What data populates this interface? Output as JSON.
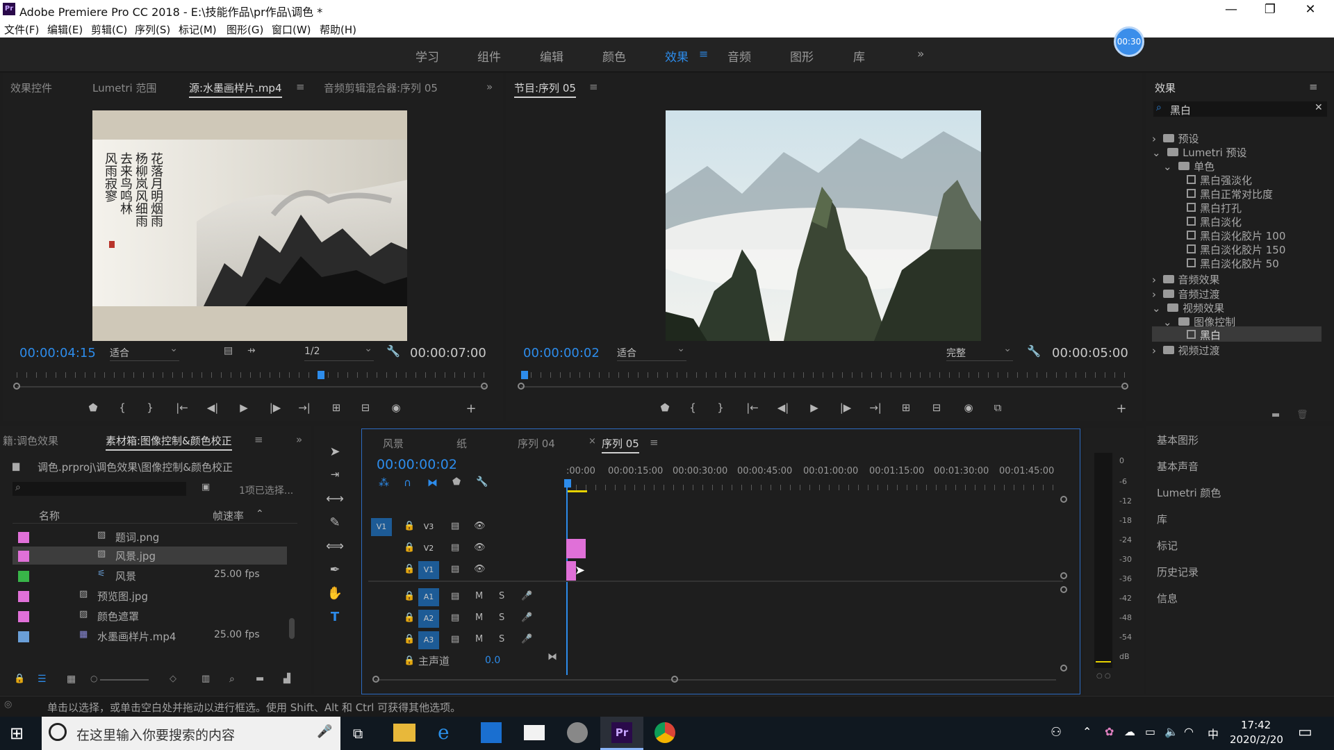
{
  "app": {
    "title": "Adobe Premiere Pro CC 2018 - E:\\技能作品\\pr作品\\调色 *",
    "logo": "Pr"
  },
  "menu": [
    "文件(F)",
    "编辑(E)",
    "剪辑(C)",
    "序列(S)",
    "标记(M)",
    "图形(G)",
    "窗口(W)",
    "帮助(H)"
  ],
  "workspaces": {
    "tabs": [
      "学习",
      "组件",
      "编辑",
      "颜色",
      "效果",
      "音频",
      "图形",
      "库"
    ],
    "active": "效果",
    "more": "»"
  },
  "timer_badge": "00:30",
  "source_panel": {
    "tabs": [
      "效果控件",
      "Lumetri 范围",
      "源:水墨画样片.mp4",
      "音频剪辑混合器:序列 05"
    ],
    "active_tab": "源:水墨画样片.mp4",
    "timecode_in": "00:00:04:15",
    "fit": "适合",
    "resolution": "1/2",
    "duration": "00:00:07:00",
    "calligraphy": "花落月明烟雨\n杨柳岚风细雨\n去来鸟鸣林\n风雨寂寥"
  },
  "program_panel": {
    "title": "节目:序列 05",
    "timecode": "00:00:00:02",
    "fit": "适合",
    "quality": "完整",
    "duration": "00:00:05:00"
  },
  "effects_panel": {
    "title": "效果",
    "search_value": "黑白",
    "tree": [
      {
        "label": "预设",
        "kind": "folder",
        "level": 0,
        "open": false
      },
      {
        "label": "Lumetri 预设",
        "kind": "folder",
        "level": 0,
        "open": true
      },
      {
        "label": "单色",
        "kind": "folder",
        "level": 1,
        "open": true
      },
      {
        "label": "黑白强淡化",
        "kind": "fx",
        "level": 2
      },
      {
        "label": "黑白正常对比度",
        "kind": "fx",
        "level": 2
      },
      {
        "label": "黑白打孔",
        "kind": "fx",
        "level": 2
      },
      {
        "label": "黑白淡化",
        "kind": "fx",
        "level": 2
      },
      {
        "label": "黑白淡化胶片 100",
        "kind": "fx",
        "level": 2
      },
      {
        "label": "黑白淡化胶片 150",
        "kind": "fx",
        "level": 2
      },
      {
        "label": "黑白淡化胶片 50",
        "kind": "fx",
        "level": 2
      },
      {
        "label": "音频效果",
        "kind": "folder",
        "level": 0,
        "open": false
      },
      {
        "label": "音频过渡",
        "kind": "folder",
        "level": 0,
        "open": false
      },
      {
        "label": "视频效果",
        "kind": "folder",
        "level": 0,
        "open": true
      },
      {
        "label": "图像控制",
        "kind": "folder",
        "level": 1,
        "open": true
      },
      {
        "label": "黑白",
        "kind": "fx",
        "level": 2,
        "selected": true
      },
      {
        "label": "视频过渡",
        "kind": "folder",
        "level": 0,
        "open": false
      }
    ],
    "side_panels": [
      "基本图形",
      "基本声音",
      "Lumetri 颜色",
      "库",
      "标记",
      "历史记录",
      "信息"
    ]
  },
  "project_panel": {
    "tabs": [
      "籍:调色效果",
      "素材箱:图像控制&颜色校正"
    ],
    "active_tab": "素材箱:图像控制&颜色校正",
    "path": "调色.prproj\\调色效果\\图像控制&颜色校正",
    "selection_info": "1项已选择...",
    "columns": {
      "name": "名称",
      "fps": "帧速率"
    },
    "items": [
      {
        "name": "题词.png",
        "fps": "",
        "color": "#e070d8",
        "selected": false
      },
      {
        "name": "风景.jpg",
        "fps": "",
        "color": "#e070d8",
        "selected": true
      },
      {
        "name": "风景",
        "fps": "25.00 fps",
        "color": "#38b548",
        "selected": false
      },
      {
        "name": "预览图.jpg",
        "fps": "",
        "color": "#e070d8",
        "selected": false
      },
      {
        "name": "颜色遮罩",
        "fps": "",
        "color": "#e070d8",
        "selected": false
      },
      {
        "name": "水墨画样片.mp4",
        "fps": "25.00 fps",
        "color": "#6a9fd8",
        "selected": false
      }
    ]
  },
  "timeline": {
    "tabs": [
      "风景",
      "纸",
      "序列 04",
      "序列 05"
    ],
    "active_tab": "序列 05",
    "close_glyph": "×",
    "timecode": "00:00:00:02",
    "ruler": [
      ":00:00",
      "00:00:15:00",
      "00:00:30:00",
      "00:00:45:00",
      "00:01:00:00",
      "00:01:15:00",
      "00:01:30:00",
      "00:01:45:00"
    ],
    "video_tracks": [
      "V3",
      "V2",
      "V1"
    ],
    "audio_tracks": [
      "A3",
      "A2",
      "A1"
    ],
    "master": {
      "label": "主声道",
      "value": "0.0"
    },
    "source_patch": "V1",
    "mute_label": "M",
    "solo_label": "S"
  },
  "audio_meter": {
    "labels": [
      "0",
      "-6",
      "-12",
      "-18",
      "-24",
      "-30",
      "-36",
      "-42",
      "-48",
      "-54",
      "dB"
    ]
  },
  "status_bar": {
    "text": "单击以选择，或单击空白处并拖动以进行框选。使用 Shift、Alt 和 Ctrl 可获得其他选项。"
  },
  "taskbar": {
    "search_placeholder": "在这里输入你要搜索的内容",
    "time": "17:42",
    "date": "2020/2/20",
    "ime": "中",
    "pr_label": "Pr"
  },
  "colors": {
    "accent": "#2d8ceb",
    "clip_pink": "#e070d8",
    "track_blue": "#1d5b96",
    "panel_bg": "#1e1e1e"
  }
}
